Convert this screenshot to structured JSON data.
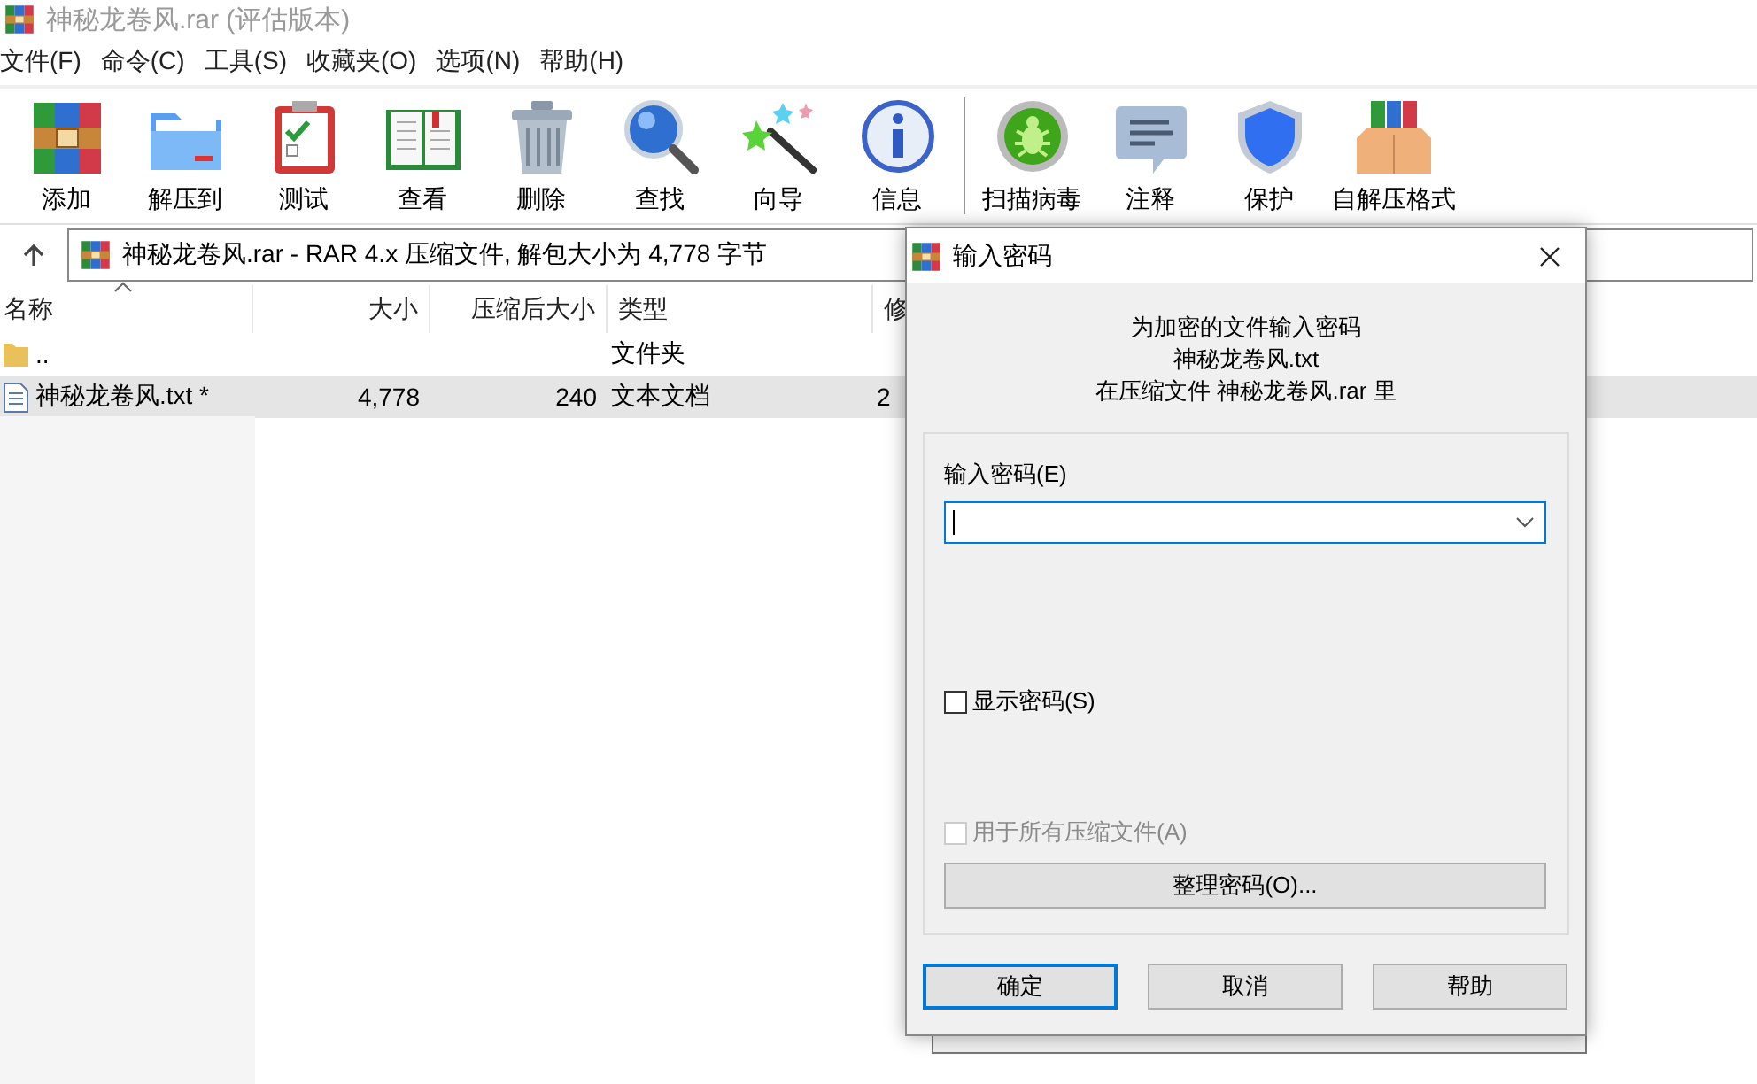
{
  "window": {
    "title": "神秘龙卷风.rar (评估版本)",
    "active": false
  },
  "menu": [
    "文件(F)",
    "命令(C)",
    "工具(S)",
    "收藏夹(O)",
    "选项(N)",
    "帮助(H)"
  ],
  "toolbar": [
    {
      "label": "添加"
    },
    {
      "label": "解压到"
    },
    {
      "label": "测试"
    },
    {
      "label": "查看"
    },
    {
      "label": "删除"
    },
    {
      "label": "查找"
    },
    {
      "label": "向导"
    },
    {
      "label": "信息"
    },
    {
      "label": "扫描病毒"
    },
    {
      "label": "注释"
    },
    {
      "label": "保护"
    },
    {
      "label": "自解压格式"
    }
  ],
  "address": {
    "text": "神秘龙卷风.rar - RAR 4.x 压缩文件, 解包大小为 4,778 字节"
  },
  "table": {
    "columns": [
      {
        "label": "名称",
        "sorted": true
      },
      {
        "label": "大小"
      },
      {
        "label": "压缩后大小"
      },
      {
        "label": "类型"
      },
      {
        "label": "修"
      }
    ],
    "rows": [
      {
        "kind": "folder",
        "name": "..",
        "type": "文件夹",
        "selected": false
      },
      {
        "kind": "text",
        "name": "神秘龙卷风.txt *",
        "size": "4,778",
        "packed": "240",
        "type": "文本文档",
        "column_5": "2",
        "selected": true
      }
    ]
  },
  "dialog": {
    "title": "输入密码",
    "message": [
      "为加密的文件输入密码",
      "神秘龙卷风.txt",
      "在压缩文件 神秘龙卷风.rar 里"
    ],
    "password_label": "输入密码(E)",
    "password_focused": true,
    "show_password": {
      "label": "显示密码(S)",
      "checked": false,
      "disabled": false
    },
    "use_for_all": {
      "label": "用于所有压缩文件(A)",
      "checked": false,
      "disabled": true
    },
    "organize_button": "整理密码(O)...",
    "buttons": [
      {
        "label": "确定",
        "default": true
      },
      {
        "label": "取消",
        "default": false
      },
      {
        "label": "帮助",
        "default": false
      }
    ]
  }
}
